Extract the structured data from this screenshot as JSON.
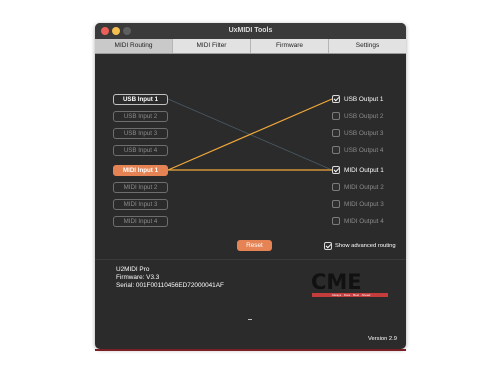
{
  "window": {
    "title": "UxMIDI Tools"
  },
  "tabs": [
    {
      "label": "MIDI Routing",
      "active": true
    },
    {
      "label": "MIDI Filter",
      "active": false
    },
    {
      "label": "Firmware",
      "active": false
    },
    {
      "label": "Settings",
      "active": false
    }
  ],
  "inputs": [
    {
      "label": "USB Input 1",
      "state": "connected"
    },
    {
      "label": "USB Input 2",
      "state": "idle"
    },
    {
      "label": "USB Input 3",
      "state": "idle"
    },
    {
      "label": "USB Input 4",
      "state": "idle"
    },
    {
      "label": "MIDI Input 1",
      "state": "selected"
    },
    {
      "label": "MIDI Input 2",
      "state": "idle"
    },
    {
      "label": "MIDI Input 3",
      "state": "idle"
    },
    {
      "label": "MIDI Input 4",
      "state": "idle"
    }
  ],
  "outputs": [
    {
      "label": "USB Output 1",
      "checked": true
    },
    {
      "label": "USB Output 2",
      "checked": false
    },
    {
      "label": "USB Output 3",
      "checked": false
    },
    {
      "label": "USB Output 4",
      "checked": false
    },
    {
      "label": "MIDI Output 1",
      "checked": true
    },
    {
      "label": "MIDI Output 2",
      "checked": false
    },
    {
      "label": "MIDI Output 3",
      "checked": false
    },
    {
      "label": "MIDI Output 4",
      "checked": false
    }
  ],
  "routes": [
    {
      "from": "MIDI Input 1",
      "to": "USB Output 1",
      "active": true
    },
    {
      "from": "MIDI Input 1",
      "to": "MIDI Output 1",
      "active": true
    },
    {
      "from": "USB Input 1",
      "to": "MIDI Output 1",
      "active": false
    }
  ],
  "controls": {
    "reset_label": "Reset",
    "advanced_label": "Show advanced routing",
    "advanced_checked": true
  },
  "device": {
    "name": "U2MIDI Pro",
    "firmware": "Firmware: V3.3",
    "serial": "Serial: 001F00110456ED72000041AF"
  },
  "logo": {
    "text": "CME",
    "tagline": "Always · Dare · Best · Ahead"
  },
  "footer": {
    "version": "Version 2.9"
  },
  "colors": {
    "accent": "#e58355",
    "route_active": "#f0a83a",
    "route_inactive": "#4a5a63",
    "window_bg": "#2b2b2b"
  }
}
